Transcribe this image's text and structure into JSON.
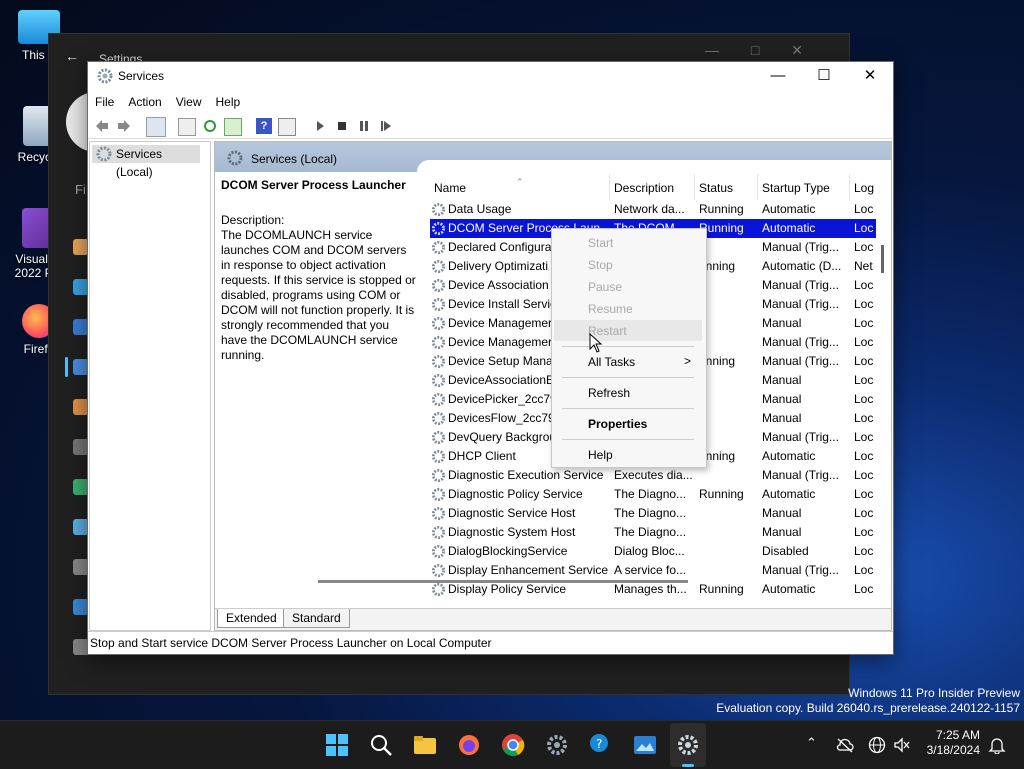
{
  "desktop": {
    "icons": [
      {
        "label": "This P"
      },
      {
        "label": "Recycle"
      },
      {
        "label": "Visual St 2022 Pre"
      },
      {
        "label": "Firefo"
      }
    ]
  },
  "settings_window": {
    "title": "Settings",
    "search_fragment": "Fi"
  },
  "services_window": {
    "title": "Services",
    "menu": [
      "File",
      "Action",
      "View",
      "Help"
    ],
    "tree_item": "Services (Local)",
    "pane_header": "Services (Local)",
    "selected_service": {
      "name": "DCOM Server Process Launcher",
      "description_label": "Description:",
      "description": "The DCOMLAUNCH service launches COM and DCOM servers in response to object activation requests. If this service is stopped or disabled, programs using COM or DCOM will not function properly. It is strongly recommended that you have the DCOMLAUNCH service running."
    },
    "columns": [
      "Name",
      "Description",
      "Status",
      "Startup Type",
      "Log"
    ],
    "rows": [
      {
        "name": "Data Usage",
        "description": "Network da...",
        "status": "Running",
        "startup": "Automatic",
        "log": "Loc"
      },
      {
        "name": "DCOM Server Process Laun...",
        "description": "The DCOM...",
        "status": "Running",
        "startup": "Automatic",
        "log": "Loc"
      },
      {
        "name": "Declared Configura",
        "description": "",
        "status": "",
        "startup": "Manual (Trig...",
        "log": "Loc"
      },
      {
        "name": "Delivery Optimizati",
        "description": "",
        "status": "unning",
        "startup": "Automatic (D...",
        "log": "Net"
      },
      {
        "name": "Device Association",
        "description": "",
        "status": "",
        "startup": "Manual (Trig...",
        "log": "Loc"
      },
      {
        "name": "Device Install Servic",
        "description": "",
        "status": "",
        "startup": "Manual (Trig...",
        "log": "Loc"
      },
      {
        "name": "Device Managemer",
        "description": "",
        "status": "",
        "startup": "Manual",
        "log": "Loc"
      },
      {
        "name": "Device Managemer",
        "description": "",
        "status": "",
        "startup": "Manual (Trig...",
        "log": "Loc"
      },
      {
        "name": "Device Setup Mana",
        "description": "",
        "status": "unning",
        "startup": "Manual (Trig...",
        "log": "Loc"
      },
      {
        "name": "DeviceAssociationE",
        "description": "",
        "status": "",
        "startup": "Manual",
        "log": "Loc"
      },
      {
        "name": "DevicePicker_2cc79",
        "description": "",
        "status": "",
        "startup": "Manual",
        "log": "Loc"
      },
      {
        "name": "DevicesFlow_2cc79",
        "description": "",
        "status": "",
        "startup": "Manual",
        "log": "Loc"
      },
      {
        "name": "DevQuery Backgrou",
        "description": "",
        "status": "",
        "startup": "Manual (Trig...",
        "log": "Loc"
      },
      {
        "name": "DHCP Client",
        "description": "",
        "status": "unning",
        "startup": "Automatic",
        "log": "Loc"
      },
      {
        "name": "Diagnostic Execution Service",
        "description": "Executes dia...",
        "status": "",
        "startup": "Manual (Trig...",
        "log": "Loc"
      },
      {
        "name": "Diagnostic Policy Service",
        "description": "The Diagno...",
        "status": "Running",
        "startup": "Automatic",
        "log": "Loc"
      },
      {
        "name": "Diagnostic Service Host",
        "description": "The Diagno...",
        "status": "",
        "startup": "Manual",
        "log": "Loc"
      },
      {
        "name": "Diagnostic System Host",
        "description": "The Diagno...",
        "status": "",
        "startup": "Manual",
        "log": "Loc"
      },
      {
        "name": "DialogBlockingService",
        "description": "Dialog Bloc...",
        "status": "",
        "startup": "Disabled",
        "log": "Loc"
      },
      {
        "name": "Display Enhancement Service",
        "description": "A service fo...",
        "status": "",
        "startup": "Manual (Trig...",
        "log": "Loc"
      },
      {
        "name": "Display Policy Service",
        "description": "Manages th...",
        "status": "Running",
        "startup": "Automatic",
        "log": "Loc"
      }
    ],
    "tabs": [
      "Extended",
      "Standard"
    ],
    "statusbar": "Stop and Start service DCOM Server Process Launcher on Local Computer"
  },
  "context_menu": {
    "items": [
      {
        "label": "Start",
        "enabled": false
      },
      {
        "label": "Stop",
        "enabled": false
      },
      {
        "label": "Pause",
        "enabled": false
      },
      {
        "label": "Resume",
        "enabled": false
      },
      {
        "label": "Restart",
        "enabled": false
      },
      {
        "label": "All Tasks",
        "enabled": true
      },
      {
        "label": "Refresh",
        "enabled": true
      },
      {
        "label": "Properties",
        "enabled": true
      },
      {
        "label": "Help",
        "enabled": true
      }
    ],
    "submenu_arrow": ">"
  },
  "watermark": {
    "line1": "Windows 11 Pro Insider Preview",
    "line2": "Evaluation copy. Build 26040.rs_prerelease.240122-1157"
  },
  "clock": {
    "time": "7:25 AM",
    "date": "3/18/2024"
  },
  "colors": {
    "selection": "#0a14d6",
    "accent": "#4cc2ff"
  }
}
